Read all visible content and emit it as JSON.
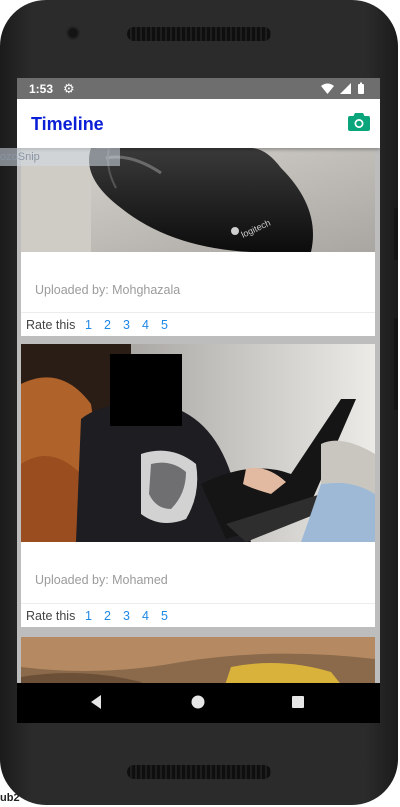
{
  "status_bar": {
    "time": "1:53",
    "icons": [
      "settings-gear",
      "wifi",
      "signal",
      "battery"
    ]
  },
  "app_bar": {
    "title": "Timeline",
    "title_color": "#0b1fd6",
    "camera_icon_color": "#0aa57a"
  },
  "posts": [
    {
      "photo": "computer-mouse-close-up",
      "uploaded_by": "Uploaded by: Mohghazala",
      "rate_label": "Rate this",
      "ratings": [
        "1",
        "2",
        "3",
        "4",
        "5"
      ]
    },
    {
      "photo": "person-with-laptop-face-redacted",
      "uploaded_by": "Uploaded by: Mohamed",
      "rate_label": "Rate this",
      "ratings": [
        "1",
        "2",
        "3",
        "4",
        "5"
      ]
    },
    {
      "photo": "partial-photo-cut-off"
    }
  ],
  "rating_link_color": "#1e88e5",
  "overlay": {
    "snip_text": "ozoSnip",
    "corner_text": "ub2"
  },
  "nav_bar": {
    "buttons": [
      "back-icon",
      "home-icon",
      "recents-icon"
    ]
  }
}
